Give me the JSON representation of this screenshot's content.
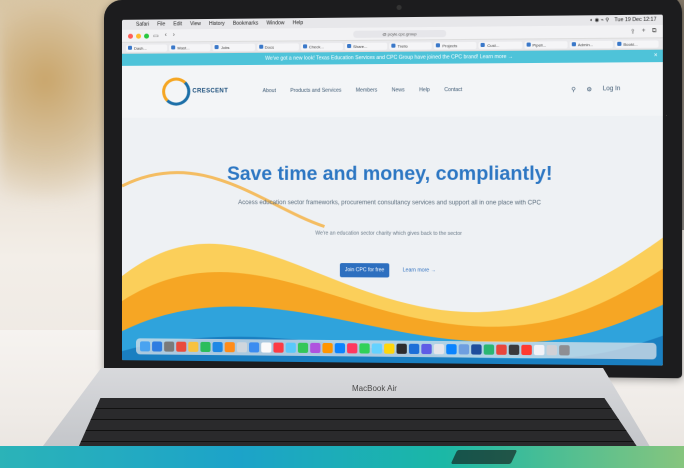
{
  "menubar": {
    "apple": "",
    "items": [
      "Safari",
      "File",
      "Edit",
      "View",
      "History",
      "Bookmarks",
      "Window",
      "Help"
    ],
    "clock": "Tue 19 Dec 12:17"
  },
  "browser": {
    "url": "@ pcyle.cpc.group",
    "tabs": [
      "Dash...",
      "Mast...",
      "Jobs",
      "Docs",
      "Check...",
      "Share...",
      "Trello",
      "Projects",
      "Cust...",
      "Pipeli...",
      "Admin...",
      "Booki..."
    ]
  },
  "banner": {
    "text": "We've got a new look! Texas Education Services and CPC Group have joined the CPC brand! Learn more →",
    "close": "×"
  },
  "nav": {
    "logo_text": "CRESCENT",
    "links": [
      "About",
      "Products and Services",
      "Members",
      "News",
      "Help",
      "Contact"
    ],
    "login": "Log In"
  },
  "hero": {
    "title": "Save time and money, compliantly!",
    "subtitle": "Access education sector frameworks, procurement consultancy services and support all in one place with CPC",
    "note": "We're an education sector charity which gives back to the sector",
    "cta_primary": "Join CPC for free",
    "cta_secondary": "Learn more →"
  },
  "device": {
    "label": "MacBook Air"
  },
  "colors": {
    "accent_blue": "#2d77c3",
    "banner_cyan": "#4ec3d9",
    "wave_orange": "#f6a624",
    "wave_yellow": "#fbcf5a",
    "wave_blue": "#2fa3dc"
  }
}
